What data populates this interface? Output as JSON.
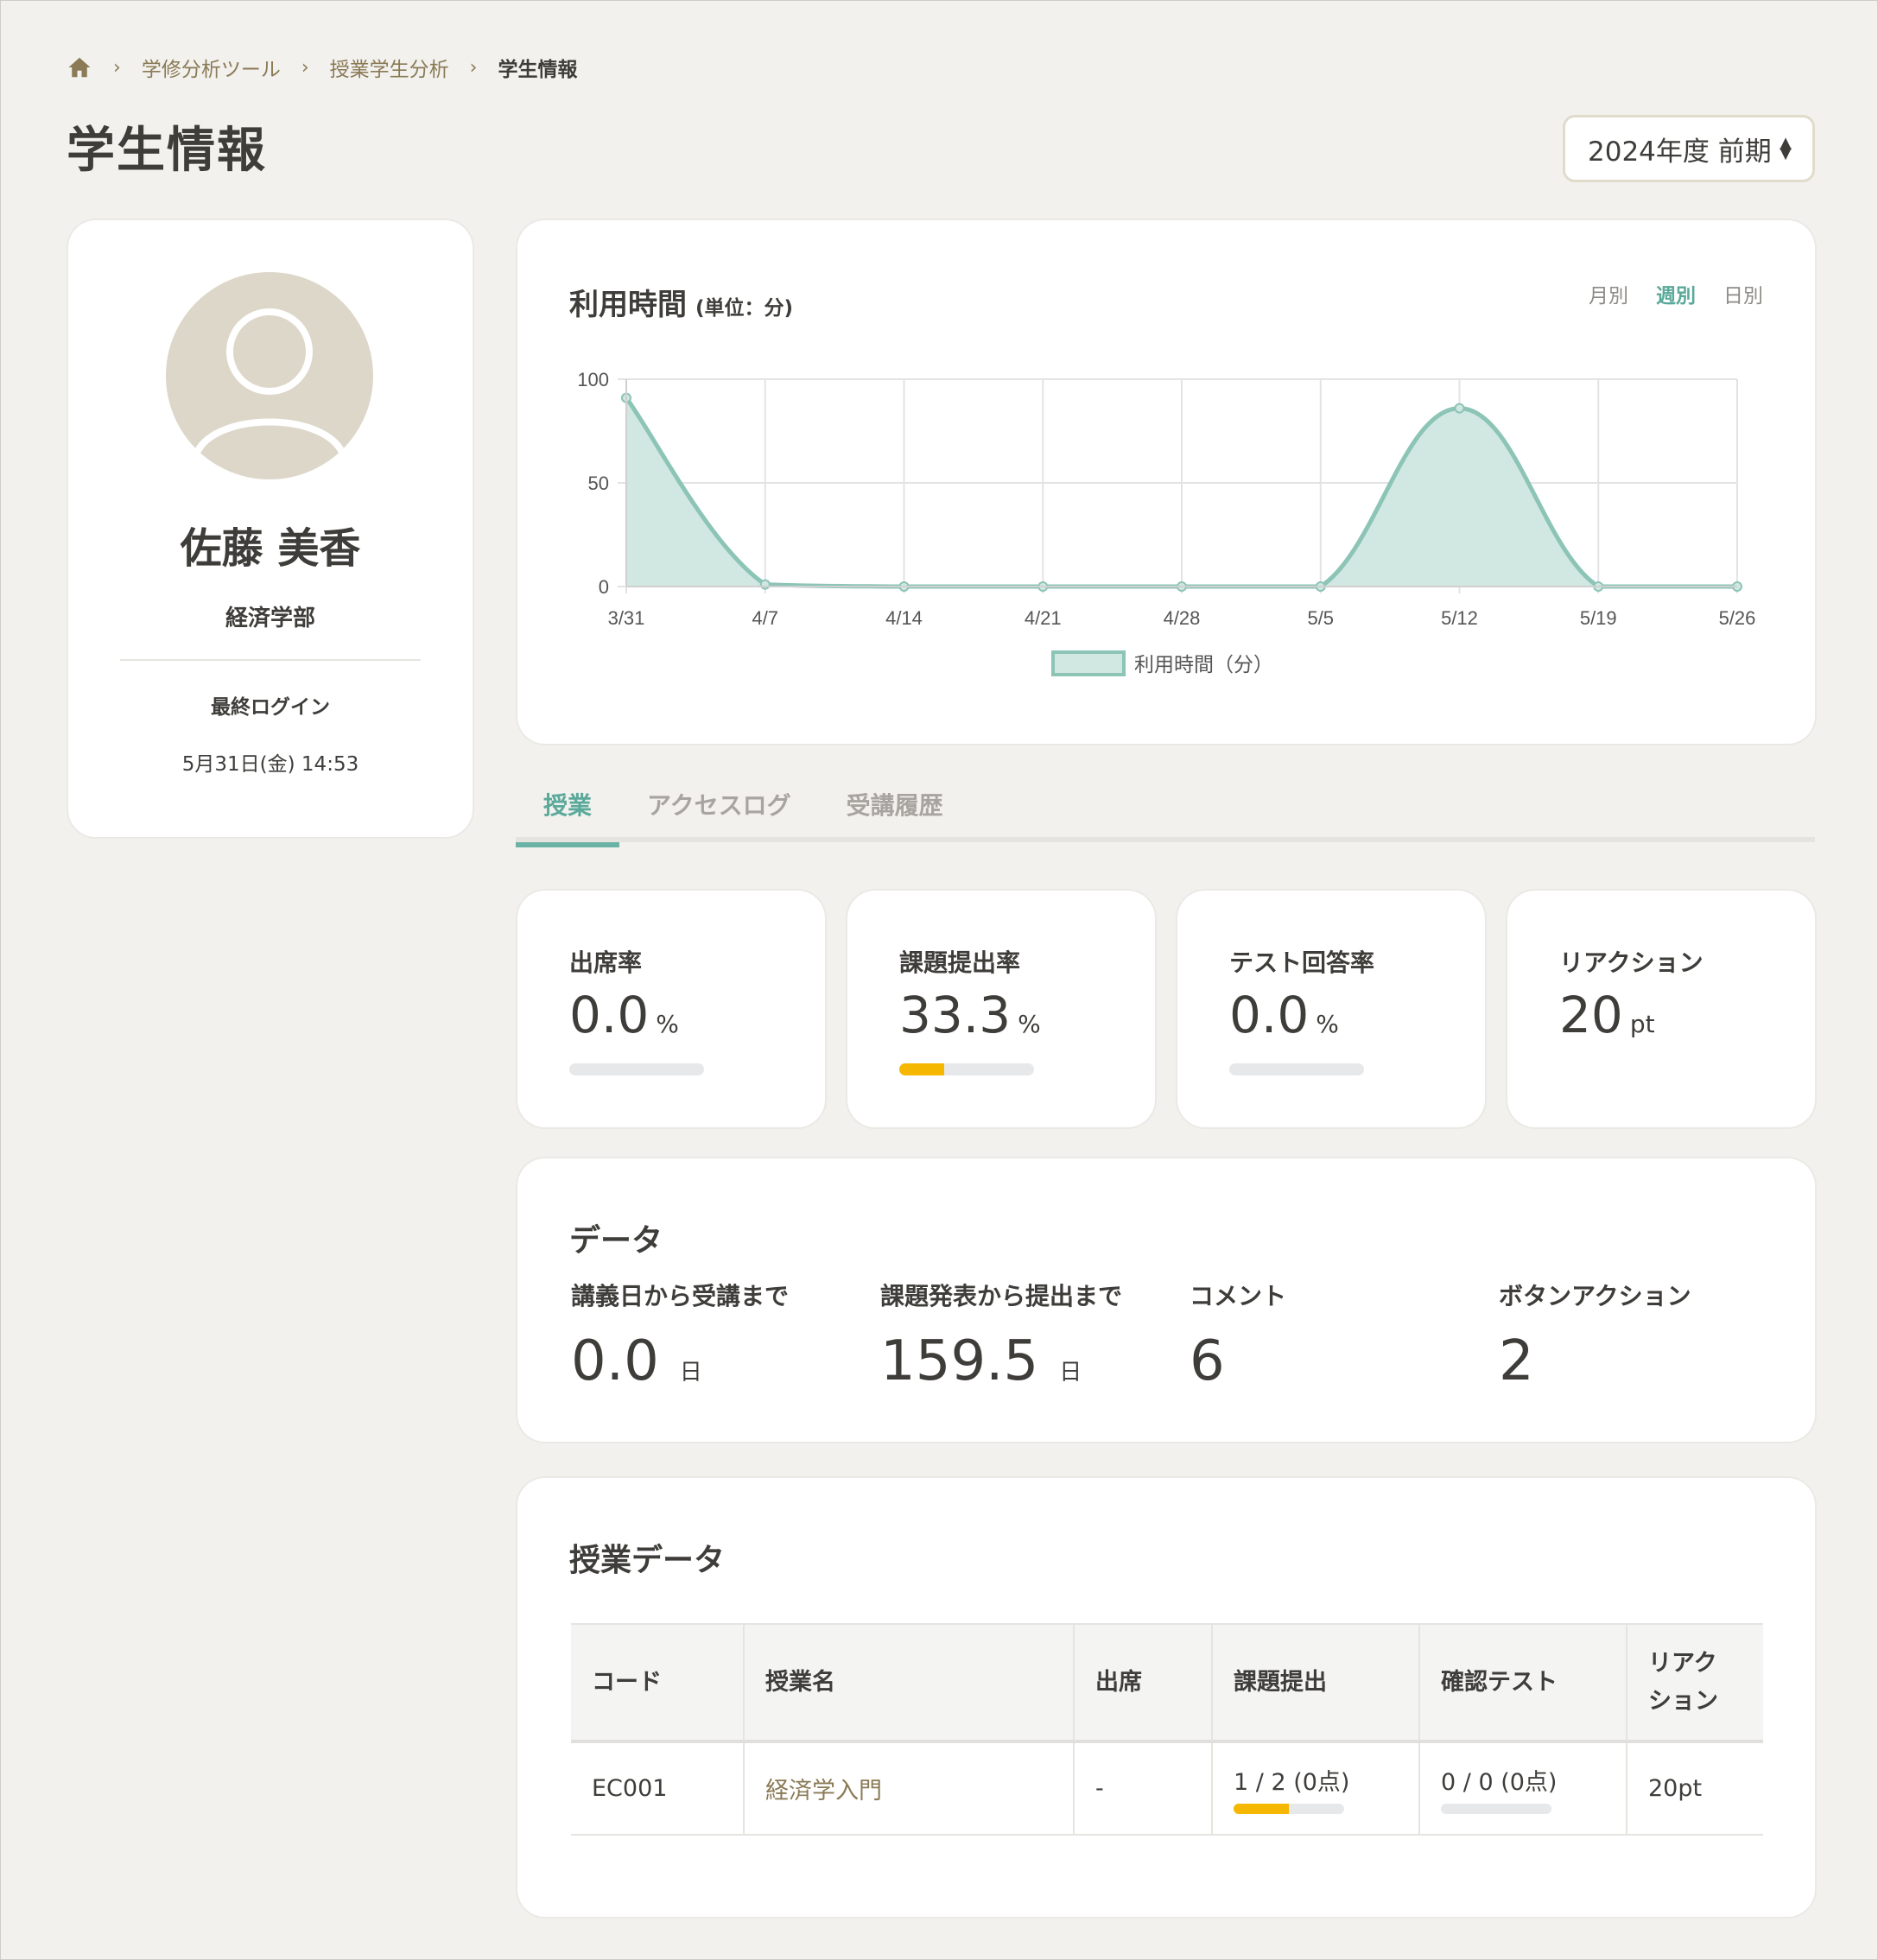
{
  "breadcrumb": {
    "items": [
      "学修分析ツール",
      "授業学生分析"
    ],
    "current": "学生情報"
  },
  "page": {
    "title": "学生情報"
  },
  "term": {
    "selected": "2024年度 前期"
  },
  "profile": {
    "name": "佐藤 美香",
    "faculty": "経済学部",
    "last_login_label": "最終ログイン",
    "last_login_value": "5月31日(金) 14:53"
  },
  "usage": {
    "title": "利用時間",
    "unit": "(単位：分)",
    "periods": [
      "月別",
      "週別",
      "日別"
    ],
    "active_period": "週別"
  },
  "chart_data": {
    "type": "area",
    "x": [
      "3/31",
      "4/7",
      "4/14",
      "4/21",
      "4/28",
      "5/5",
      "5/12",
      "5/19",
      "5/26"
    ],
    "series": [
      {
        "name": "利用時間（分）",
        "values": [
          91,
          1,
          0,
          0,
          0,
          0,
          86,
          0,
          0
        ]
      }
    ],
    "ylim": [
      0,
      100
    ],
    "yticks": [
      0,
      50,
      100
    ],
    "grid": true,
    "legend": "bottom",
    "colors": {
      "line": "#8cc4b5",
      "fill": "#d1e7e2"
    }
  },
  "tabs": {
    "items": [
      "授業",
      "アクセスログ",
      "受講履歴"
    ],
    "active": "授業"
  },
  "stats": [
    {
      "label": "出席率",
      "value": "0.0",
      "unit": "%",
      "progress": 0
    },
    {
      "label": "課題提出率",
      "value": "33.3",
      "unit": "%",
      "progress": 0.333
    },
    {
      "label": "テスト回答率",
      "value": "0.0",
      "unit": "%",
      "progress": 0
    },
    {
      "label": "リアクション",
      "value": "20",
      "unit": "pt"
    }
  ],
  "data_section": {
    "title": "データ",
    "metrics": [
      {
        "label": "講義日から受講まで",
        "value": "0.0",
        "unit": "日"
      },
      {
        "label": "課題発表から提出まで",
        "value": "159.5",
        "unit": "日"
      },
      {
        "label": "コメント",
        "value": "6",
        "unit": ""
      },
      {
        "label": "ボタンアクション",
        "value": "2",
        "unit": ""
      }
    ]
  },
  "course_data": {
    "title": "授業データ",
    "columns": [
      "コード",
      "授業名",
      "出席",
      "課題提出",
      "確認テスト",
      "リアク\nション"
    ],
    "rows": [
      {
        "code": "EC001",
        "name": "経済学入門",
        "attendance": "-",
        "assignment": "1 / 2 (0点)",
        "assignment_progress": 0.5,
        "test": "0 / 0 (0点)",
        "test_progress": 0,
        "reaction": "20pt"
      }
    ]
  },
  "colors": {
    "accent": "#5ba99a",
    "link": "#8a7a55",
    "progress": "#f6b700",
    "background": "#f2f1ee"
  }
}
